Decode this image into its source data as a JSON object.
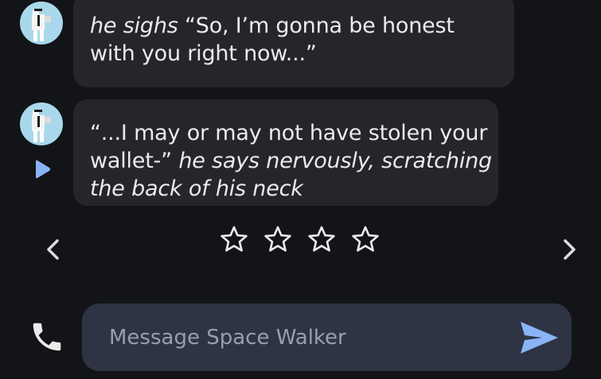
{
  "colors": {
    "background": "#131417",
    "bubble": "#25262b",
    "composer": "#2e3444",
    "accent": "#8ab4f8",
    "text": "#ebebeb",
    "placeholder": "#9a9fa9",
    "avatar": "#a9d8ec"
  },
  "messages": [
    {
      "author_avatar": "astronaut-avatar",
      "parts": [
        {
          "style": "italic",
          "text": "he sighs "
        },
        {
          "style": "normal",
          "text": "“So, I’m gonna be honest with you right now...”"
        }
      ]
    },
    {
      "author_avatar": "astronaut-avatar",
      "parts": [
        {
          "style": "normal",
          "text": "“...I may or may not have stolen your wallet-” "
        },
        {
          "style": "italic",
          "text": "he says nervously, scratching the back of his neck"
        }
      ]
    }
  ],
  "rating": {
    "stars": 4,
    "filled": 0
  },
  "icons": {
    "play": "play-icon",
    "prev": "chevron-left-icon",
    "next": "chevron-right-icon",
    "star": "star-outline-icon",
    "phone": "phone-icon",
    "send": "send-icon"
  },
  "composer": {
    "placeholder": "Message Space Walker",
    "value": ""
  }
}
